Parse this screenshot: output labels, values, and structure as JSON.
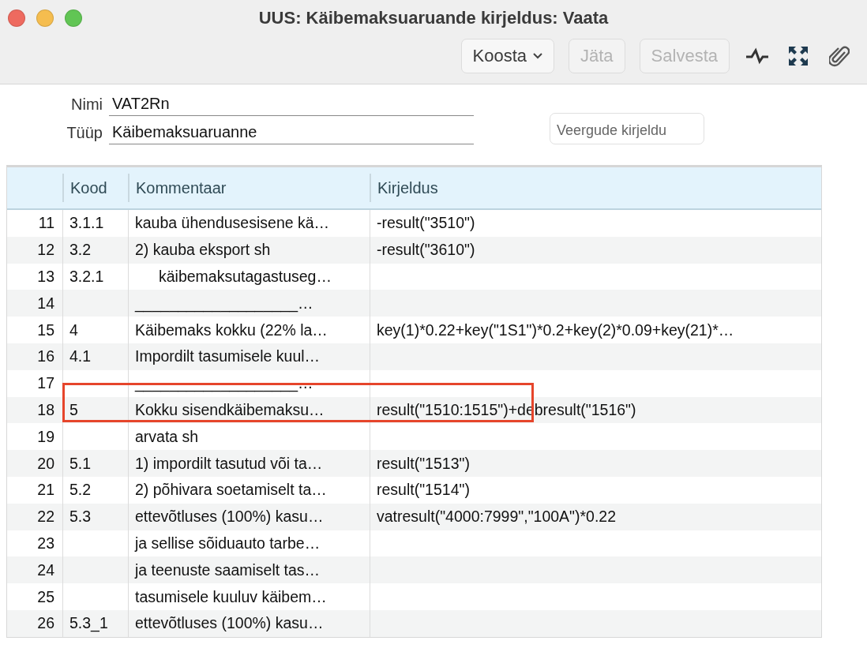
{
  "window": {
    "title": "UUS: Käibemaksuaruande kirjeldus: Vaata"
  },
  "toolbar": {
    "buttons": [
      {
        "kind": "menu",
        "label": "Koosta",
        "disabled": false
      },
      {
        "kind": "push",
        "label": "Jäta",
        "disabled": true
      },
      {
        "kind": "push",
        "label": "Salvesta",
        "disabled": true
      },
      {
        "kind": "pulse"
      },
      {
        "kind": "expand"
      },
      {
        "kind": "paperclip"
      }
    ]
  },
  "form": {
    "fields": [
      {
        "label": "Nimi",
        "value": "VAT2Rn"
      },
      {
        "label": "Tüüp",
        "value": "Käibemaksuaruanne"
      }
    ],
    "side_button": "Veergude kirjeldu"
  },
  "table": {
    "columns": [
      "Kood",
      "Kommentaar",
      "Kirjeldus"
    ],
    "rows": [
      {
        "number": "11",
        "kood": "3.1.1",
        "kommentaar": "kauba ühendusesisene kä…",
        "kirjeldus": "-result(\"3510\")",
        "indented": false,
        "highlighted": false
      },
      {
        "number": "12",
        "kood": "3.2",
        "kommentaar": "2) kauba eksport sh",
        "kirjeldus": "-result(\"3610\")",
        "indented": false,
        "highlighted": false
      },
      {
        "number": "13",
        "kood": "3.2.1",
        "kommentaar": "käibemaksutagastuseg…",
        "kirjeldus": "",
        "indented": true,
        "highlighted": false
      },
      {
        "number": "14",
        "kood": "",
        "kommentaar": "___________________…",
        "kirjeldus": "",
        "indented": false,
        "highlighted": false
      },
      {
        "number": "15",
        "kood": "4",
        "kommentaar": "Käibemaks kokku (22% la…",
        "kirjeldus": "key(1)*0.22+key(\"1S1\")*0.2+key(2)*0.09+key(21)*…",
        "indented": false,
        "highlighted": false
      },
      {
        "number": "16",
        "kood": "4.1",
        "kommentaar": "Impordilt tasumisele kuul…",
        "kirjeldus": "",
        "indented": false,
        "highlighted": false
      },
      {
        "number": "17",
        "kood": "",
        "kommentaar": "___________________…",
        "kirjeldus": "",
        "indented": false,
        "highlighted": false
      },
      {
        "number": "18",
        "kood": "5",
        "kommentaar": "Kokku sisendkäibemaksu…",
        "kirjeldus": "result(\"1510:1515\")+debresult(\"1516\")",
        "indented": false,
        "highlighted": true
      },
      {
        "number": "19",
        "kood": "",
        "kommentaar": "arvata sh",
        "kirjeldus": "",
        "indented": false,
        "highlighted": false
      },
      {
        "number": "20",
        "kood": "5.1",
        "kommentaar": "1) impordilt tasutud või ta…",
        "kirjeldus": "result(\"1513\")",
        "indented": false,
        "highlighted": false
      },
      {
        "number": "21",
        "kood": "5.2",
        "kommentaar": "2) põhivara soetamiselt ta…",
        "kirjeldus": "result(\"1514\")",
        "indented": false,
        "highlighted": false
      },
      {
        "number": "22",
        "kood": "5.3",
        "kommentaar": "ettevõtluses (100%) kasu…",
        "kirjeldus": "vatresult(\"4000:7999\",\"100A\")*0.22",
        "indented": false,
        "highlighted": false
      },
      {
        "number": "23",
        "kood": "",
        "kommentaar": "ja sellise sõiduauto tarbe…",
        "kirjeldus": "",
        "indented": false,
        "highlighted": false
      },
      {
        "number": "24",
        "kood": "",
        "kommentaar": "ja teenuste saamiselt tas…",
        "kirjeldus": "",
        "indented": false,
        "highlighted": false
      },
      {
        "number": "25",
        "kood": "",
        "kommentaar": "tasumisele kuuluv käibem…",
        "kirjeldus": "",
        "indented": false,
        "highlighted": false
      },
      {
        "number": "26",
        "kood": "5.3_1",
        "kommentaar": "ettevõtluses (100%) kasu…",
        "kirjeldus": "",
        "indented": false,
        "highlighted": false
      }
    ]
  }
}
